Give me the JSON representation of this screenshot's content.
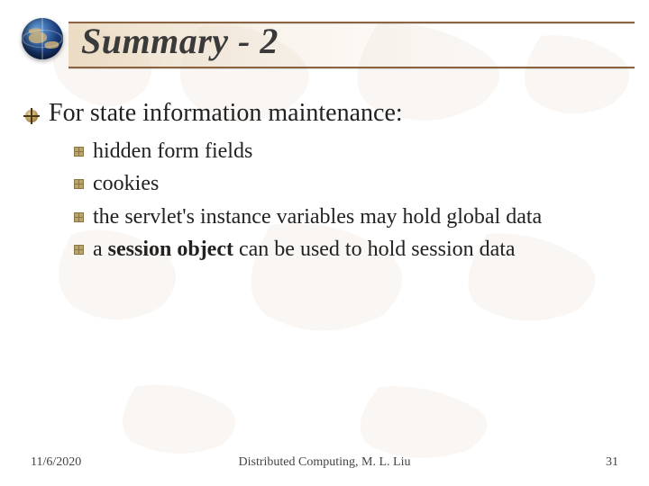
{
  "title": "Summary - 2",
  "body": {
    "lead": "For state information maintenance:",
    "items": [
      "hidden form fields",
      "cookies",
      "the servlet's instance variables may hold global data",
      "a <b>session object</b> can be used to hold session data"
    ]
  },
  "footer": {
    "date": "11/6/2020",
    "center": "Distributed Computing, M. L. Liu",
    "page": "31"
  }
}
